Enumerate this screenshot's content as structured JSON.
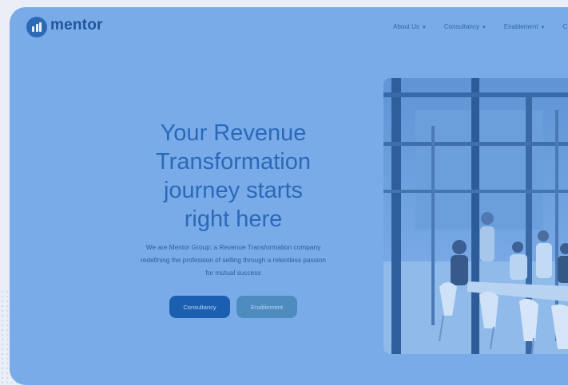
{
  "brand": {
    "name": "mentor",
    "logo_icon": "mentor-bars-logo"
  },
  "nav": {
    "items": [
      {
        "label": "About Us",
        "has_dropdown": true
      },
      {
        "label": "Consultancy",
        "has_dropdown": true
      },
      {
        "label": "Enablement",
        "has_dropdown": true
      },
      {
        "label": "C",
        "has_dropdown": false
      }
    ]
  },
  "hero": {
    "title_lines": [
      "Your Revenue",
      "Transformation",
      "journey starts",
      "right here"
    ],
    "subtitle_lines": [
      "We are Mentor Group; a Revenue Transformation company",
      "redefining the profession of selling through a relentless passion",
      "for mutual success"
    ],
    "buttons": {
      "primary": "Consultancy",
      "secondary": "Enablement"
    }
  },
  "colors": {
    "overlay": "#79abe9",
    "brand_blue": "#1f5599",
    "title_blue": "#2b69b8",
    "primary_button": "#1c5fb0",
    "secondary_button": "#4e8cbf"
  },
  "image": {
    "subject": "office-meeting-room-glass-walls"
  }
}
